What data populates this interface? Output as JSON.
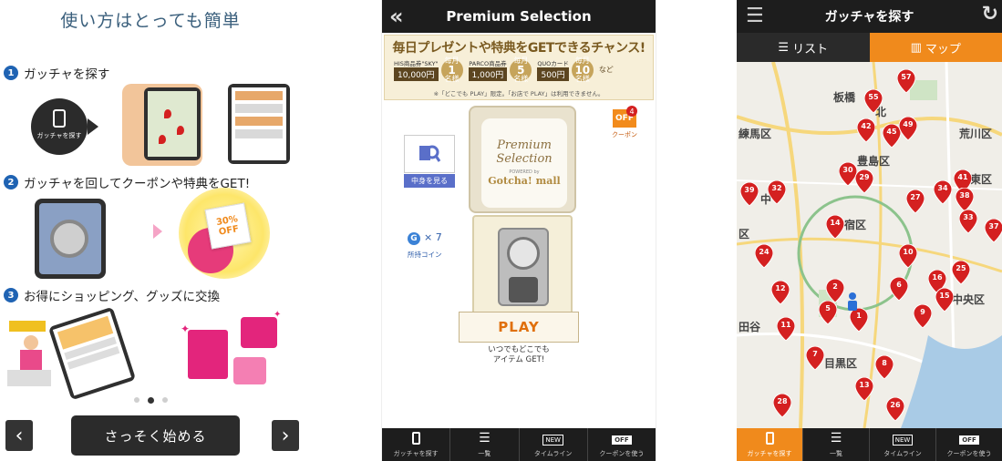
{
  "tutorial": {
    "title": "使い方はとっても簡単",
    "steps": [
      {
        "num": "1",
        "text": "ガッチャを探す"
      },
      {
        "num": "2",
        "text": "ガッチャを回してクーポンや特典をGET!"
      },
      {
        "num": "3",
        "text": "お得にショッピング、グッズに交換"
      }
    ],
    "search_bubble": "ガッチャを探す",
    "coupon_badge": "30% OFF",
    "start_button": "さっそく始める",
    "prev": "‹",
    "next": "›"
  },
  "gacha": {
    "header_title": "Premium Selection",
    "back_icon": "«",
    "banner_title": "毎日プレゼントや特典をGETできるチャンス!",
    "prizes": [
      {
        "name": "HIS商品券\"SKY\"",
        "amount": "10,000円",
        "count": "1"
      },
      {
        "name": "PARCO商品券",
        "amount": "1,000円",
        "count": "5"
      },
      {
        "name": "QUOカード",
        "amount": "500円",
        "count": "10"
      }
    ],
    "badge_top": "毎月",
    "badge_unit": "名様",
    "nado": "など",
    "banner_note": "※「どこでも PLAY」限定。「お店で PLAY」は利用できません。",
    "machine_brand_1": "Premium",
    "machine_brand_2": "Selection",
    "machine_powered": "POWERED by",
    "machine_gotcha": "Gotcha! mall",
    "view_inside": "中身を見る",
    "coin_count": "× 7",
    "coin_label": "所持コイン",
    "coupon_count": "4",
    "coupon_label": "クーポン",
    "off_text": "OFF",
    "play_button": "PLAY",
    "play_note_1": "いつでもどこでも",
    "play_note_2": "アイテム GET!"
  },
  "tabs": [
    {
      "label": "ガッチャを探す",
      "icon": "phone-icon"
    },
    {
      "label": "一覧",
      "icon": "list-icon"
    },
    {
      "label": "タイムライン",
      "icon": "new-icon"
    },
    {
      "label": "クーポンを使う",
      "icon": "off-icon"
    }
  ],
  "tab_new": "NEW",
  "tab_off": "OFF",
  "map_screen": {
    "header_title": "ガッチャを探す",
    "seg_list": "リスト",
    "seg_map": "マップ",
    "labels": [
      "板橋",
      "北",
      "荒川区",
      "練馬区",
      "豊島区",
      "中",
      "区",
      "宿区",
      "中央区",
      "田谷",
      "目黒区",
      "東区"
    ],
    "pins": [
      "55",
      "57",
      "42",
      "45",
      "49",
      "30",
      "29",
      "39",
      "32",
      "27",
      "34",
      "41",
      "38",
      "33",
      "14",
      "24",
      "37",
      "10",
      "16",
      "25",
      "12",
      "2",
      "6",
      "15",
      "5",
      "1",
      "9",
      "11",
      "7",
      "8",
      "13",
      "26",
      "28"
    ]
  },
  "colors": {
    "accent": "#f08a1c",
    "header": "#1d1d1d",
    "pin": "#d42020",
    "step": "#1f63b3"
  }
}
